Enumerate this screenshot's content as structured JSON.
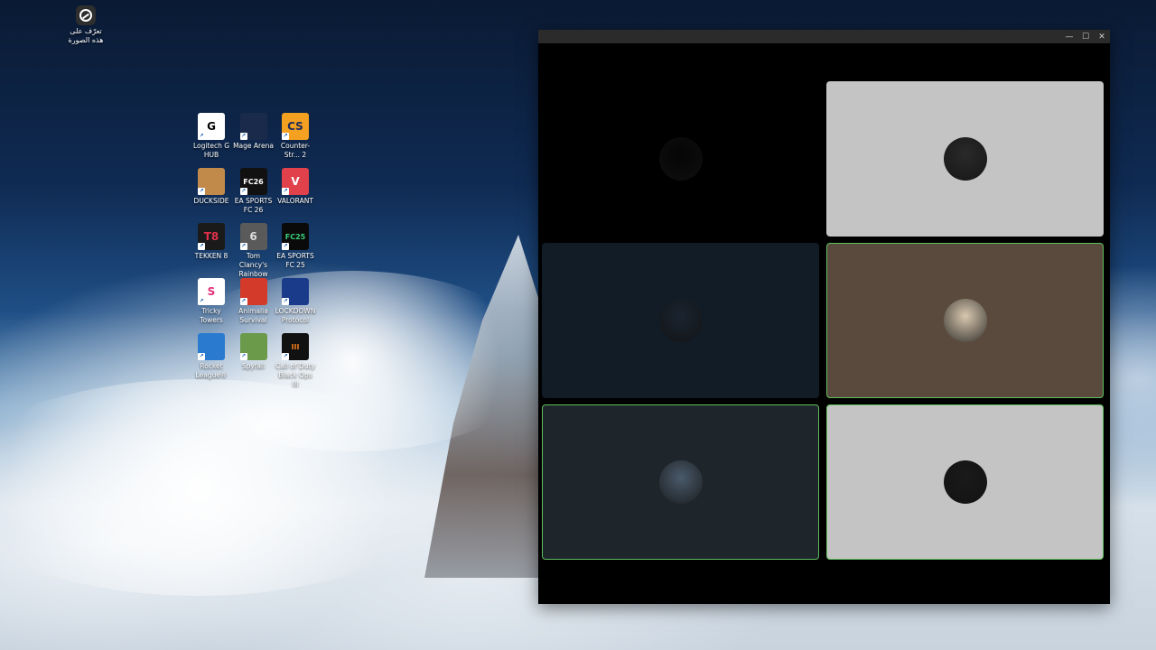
{
  "learn_icon": {
    "label_line1": "تعرّف على",
    "label_line2": "هذه الصورة",
    "icon": "learn-about-picture-icon"
  },
  "desktop_icons": [
    {
      "id": "logitech",
      "label": "Logitech G HUB",
      "glyph": "G",
      "bg": "#ffffff",
      "fg": "#000000"
    },
    {
      "id": "mage",
      "label": "Mage Arena",
      "glyph": "",
      "bg": "#1a2a4a",
      "fg": "#ffffff"
    },
    {
      "id": "cs2",
      "label": "Counter-Str... 2",
      "glyph": "CS",
      "bg": "#f4a020",
      "fg": "#1a2a5a"
    },
    {
      "id": "duckside",
      "label": "DUCKSIDE",
      "glyph": "",
      "bg": "#c28a4a",
      "fg": "#ffffff"
    },
    {
      "id": "fc26",
      "label": "EA SPORTS FC 26",
      "glyph": "FC26",
      "bg": "#111111",
      "fg": "#ffffff"
    },
    {
      "id": "valorant",
      "label": "VALORANT",
      "glyph": "V",
      "bg": "#e0414a",
      "fg": "#ffffff"
    },
    {
      "id": "tekken",
      "label": "TEKKEN 8",
      "glyph": "T8",
      "bg": "#1a1a1a",
      "fg": "#e0304a"
    },
    {
      "id": "r6",
      "label": "Tom Clancy's Rainbow Si...",
      "glyph": "6",
      "bg": "#5a5a5a",
      "fg": "#dddddd"
    },
    {
      "id": "fc25",
      "label": "EA SPORTS FC 25",
      "glyph": "FC25",
      "bg": "#0a0a0a",
      "fg": "#3ad07a"
    },
    {
      "id": "tricky",
      "label": "Tricky Towers",
      "glyph": "S",
      "bg": "#ffffff",
      "fg": "#e0307a"
    },
    {
      "id": "animalia",
      "label": "Animalia Survival",
      "glyph": "",
      "bg": "#d43a2a",
      "fg": "#ffffff"
    },
    {
      "id": "lockdown",
      "label": "LOCKDOWN Protocol",
      "glyph": "",
      "bg": "#1a3a8a",
      "fg": "#ffffff"
    },
    {
      "id": "rocket",
      "label": "Rocket League®",
      "glyph": "",
      "bg": "#2a7ad0",
      "fg": "#ffffff"
    },
    {
      "id": "spyfall",
      "label": "Spyfall",
      "glyph": "",
      "bg": "#6a9a4a",
      "fg": "#ffffff"
    },
    {
      "id": "codbo3",
      "label": "Call of Duty Black Ops III",
      "glyph": "III",
      "bg": "#111111",
      "fg": "#f07a1a"
    }
  ],
  "window": {
    "controls": {
      "minimize": "—",
      "maximize": "☐",
      "close": "✕"
    },
    "tiles": [
      {
        "bg": "#000000",
        "active": false,
        "avatar_bg": "#050505"
      },
      {
        "bg": "#c4c4c4",
        "active": false,
        "avatar_bg": "#2a2a2a"
      },
      {
        "bg": "#111c27",
        "active": false,
        "avatar_bg": "#1a2430"
      },
      {
        "bg": "#5a4a3e",
        "active": true,
        "avatar_bg": "#d8c8b0"
      },
      {
        "bg": "#1e252b",
        "active": true,
        "avatar_bg": "#4a5a6a"
      },
      {
        "bg": "#c4c4c4",
        "active": true,
        "avatar_bg": "#1a1a1a"
      }
    ]
  }
}
